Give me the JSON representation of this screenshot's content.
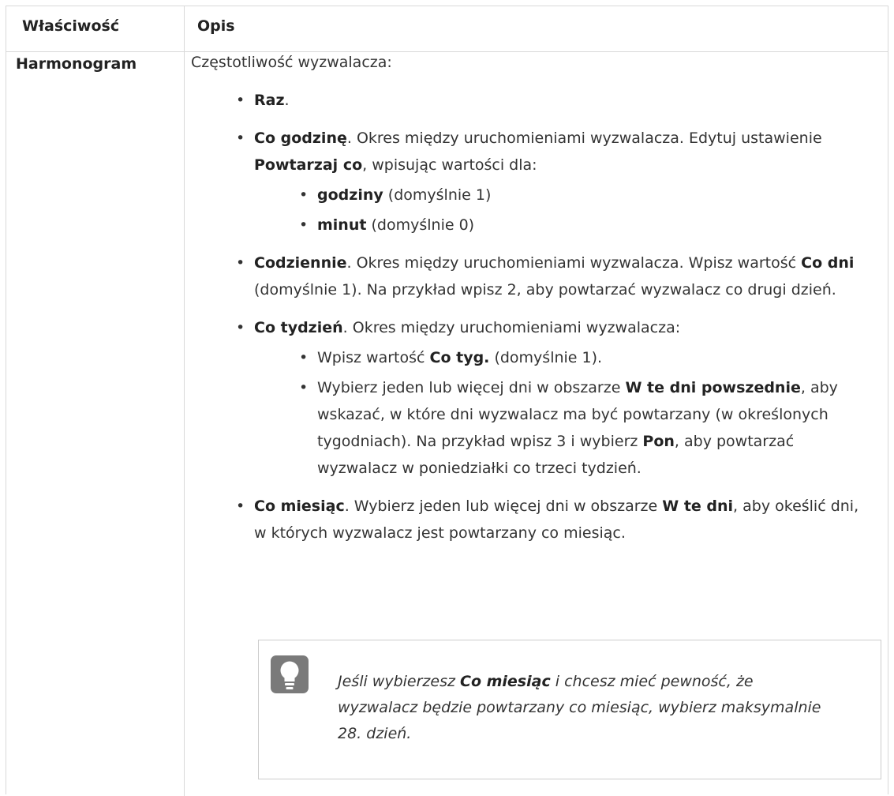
{
  "table": {
    "header": {
      "col1": "Właściwość",
      "col2": "Opis"
    },
    "row": {
      "property": "Harmonogram",
      "intro": "Częstotliwość wyzwalacza:",
      "raz": {
        "bold": "Raz",
        "rest": "."
      },
      "hourly": {
        "bold": "Co godzinę",
        "text1": ". Okres między uruchomieniami wyzwalacza. Edytuj ustawienie ",
        "bold2": "Powtarzaj co",
        "text2": ", wpisując wartości dla:",
        "sub": [
          {
            "bold": "godziny",
            "rest": " (domyślnie 1)"
          },
          {
            "bold": "minut",
            "rest": " (domyślnie 0)"
          }
        ]
      },
      "daily": {
        "bold": "Codziennie",
        "text1": ". Okres między uruchomieniami wyzwalacza. Wpisz wartość ",
        "bold2": "Co dni",
        "text2": " (domyślnie 1). Na przykład wpisz 2, aby powtarzać wyzwalacz co drugi dzień."
      },
      "weekly": {
        "bold": "Co tydzień",
        "text1": ". Okres między uruchomieniami wyzwalacza:",
        "sub1": {
          "pre": "Wpisz wartość ",
          "bold": "Co tyg.",
          "rest": " (domyślnie 1)."
        },
        "sub2": {
          "pre": "Wybierz jeden lub więcej dni w obszarze ",
          "bold": "W te dni powszednie",
          "mid": ", aby wskazać, w które dni wyzwalacz ma być powtarzany (w określonych tygodniach). Na przykład wpisz 3 i wybierz ",
          "bold2": "Pon",
          "rest": ", aby powtarzać wyzwalacz w poniedziałki co trzeci tydzień."
        }
      },
      "monthly": {
        "bold": "Co miesiąc",
        "text1": ". Wybierz jeden lub więcej dni w obszarze ",
        "bold2": "W te dni",
        "text2": ", aby okeślić dni, w których wyzwalacz jest powtarzany co miesiąc."
      },
      "tip": {
        "icon": "lightbulb-icon",
        "pre": "Jeśli wybierzesz ",
        "bold": "Co miesiąc",
        "rest": " i chcesz mieć pewność, że wyzwalacz będzie powtarzany co miesiąc, wybierz maksymalnie 28. dzień."
      }
    }
  }
}
